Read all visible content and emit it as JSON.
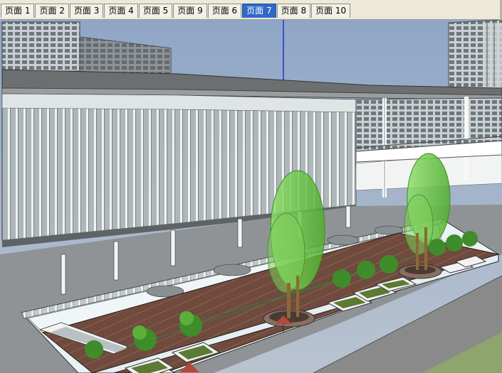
{
  "scene_tabs": [
    {
      "label": "页面 1",
      "active": false
    },
    {
      "label": "页面 2",
      "active": false
    },
    {
      "label": "页面 3",
      "active": false
    },
    {
      "label": "页面 4",
      "active": false
    },
    {
      "label": "页面 5",
      "active": false
    },
    {
      "label": "页面 9",
      "active": false
    },
    {
      "label": "页面 6",
      "active": false
    },
    {
      "label": "页面 7",
      "active": true
    },
    {
      "label": "页面 8",
      "active": false
    },
    {
      "label": "页面 10",
      "active": false
    }
  ],
  "colors": {
    "sky": "#9fb0c9",
    "active_tab": "#316ac5",
    "building_wall": "#9ba4a8",
    "deck_wood": "#6e4a3e",
    "tree_green": "#66cc44",
    "road": "#8a8a8a",
    "lawn": "#8fa56e"
  },
  "viewport": {
    "description_icon": "sketchup-3d-model-view"
  }
}
